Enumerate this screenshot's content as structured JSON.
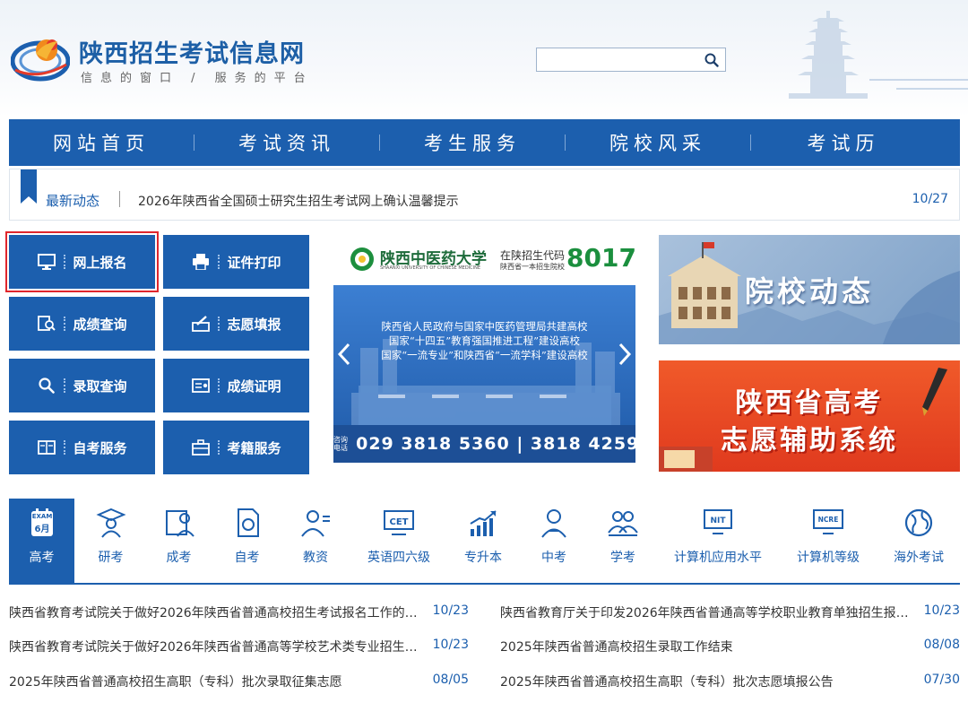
{
  "header": {
    "site_title": "陕西招生考试信息网",
    "slogan": "信息的窗口 / 服务的平台",
    "search_placeholder": ""
  },
  "nav": {
    "items": [
      "网站首页",
      "考试资讯",
      "考生服务",
      "院校风采",
      "考试历"
    ]
  },
  "ticker": {
    "label": "最新动态",
    "text": "2026年陕西省全国硕士研究生招生考试网上确认温馨提示",
    "date": "10/27"
  },
  "services": [
    {
      "label": "网上报名",
      "icon": "monitor-icon"
    },
    {
      "label": "证件打印",
      "icon": "printer-icon"
    },
    {
      "label": "成绩查询",
      "icon": "score-search-icon"
    },
    {
      "label": "志愿填报",
      "icon": "form-fill-icon"
    },
    {
      "label": "录取查询",
      "icon": "search-icon"
    },
    {
      "label": "成绩证明",
      "icon": "certificate-icon"
    },
    {
      "label": "自考服务",
      "icon": "book-icon"
    },
    {
      "label": "考籍服务",
      "icon": "briefcase-icon"
    }
  ],
  "banner": {
    "univ_name": "陕西中医药大学",
    "univ_en": "SHAANXI UNIVERSITY OF CHINESE MEDICINE",
    "code_label": "在陕招生代码",
    "code_sub": "陕西省一本招生院校",
    "code_num": "8017",
    "lines": [
      "陕西省人民政府与国家中医药管理局共建高校",
      "国家“十四五”教育强国推进工程”建设高校",
      "国家“一流专业”和陕西省“一流学科”建设高校"
    ],
    "phone_label_1": "咨询",
    "phone_label_2": "电话",
    "phone": "029 3818 5360 | 3818 4259"
  },
  "panels": {
    "college_news": "院校动态",
    "gaokao_line1": "陕西省高考",
    "gaokao_line2": "志愿辅助系统"
  },
  "categories": [
    {
      "label": "高考",
      "icon": "exam-calendar-icon",
      "badge_top": "EXAM",
      "badge_bottom": "6月"
    },
    {
      "label": "研考",
      "icon": "graduate-icon"
    },
    {
      "label": "成考",
      "icon": "adult-exam-icon"
    },
    {
      "label": "自考",
      "icon": "self-study-icon"
    },
    {
      "label": "教资",
      "icon": "teacher-icon"
    },
    {
      "label": "英语四六级",
      "icon": "cet-icon",
      "badge": "CET"
    },
    {
      "label": "专升本",
      "icon": "growth-chart-icon"
    },
    {
      "label": "中考",
      "icon": "student-icon"
    },
    {
      "label": "学考",
      "icon": "group-icon"
    },
    {
      "label": "计算机应用水平",
      "icon": "nit-icon",
      "badge": "NIT"
    },
    {
      "label": "计算机等级",
      "icon": "ncre-icon",
      "badge": "NCRE"
    },
    {
      "label": "海外考试",
      "icon": "globe-icon"
    }
  ],
  "news": [
    {
      "title": "陕西省教育考试院关于做好2026年陕西省普通高校招生考试报名工作的…",
      "date": "10/23"
    },
    {
      "title": "陕西省教育厅关于印发2026年陕西省普通高等学校职业教育单独招生报…",
      "date": "10/23"
    },
    {
      "title": "陕西省教育考试院关于做好2026年陕西省普通高等学校艺术类专业招生…",
      "date": "10/23"
    },
    {
      "title": "2025年陕西省普通高校招生录取工作结束",
      "date": "08/08"
    },
    {
      "title": "2025年陕西省普通高校招生高职（专科）批次录取征集志愿",
      "date": "08/05"
    },
    {
      "title": "2025年陕西省普通高校招生高职（专科）批次志愿填报公告",
      "date": "07/30"
    }
  ],
  "colors": {
    "brand_blue": "#1c5fae",
    "active_outline": "#e0262c",
    "orange_panel": "#e03a1e"
  }
}
